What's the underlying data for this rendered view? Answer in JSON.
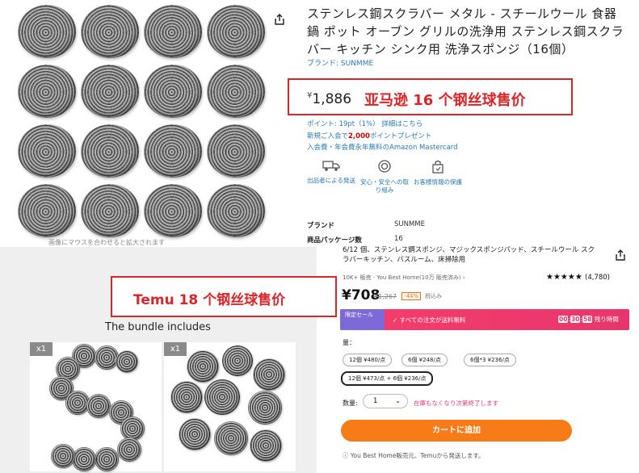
{
  "amazon": {
    "title": "ステンレス鋼スクラバー メタル - スチールウール 食器 鍋 ポット オーブン グリルの洗浄用 ステンレス鋼スクラバー キッチン シンク用 洗浄スポンジ（16個）",
    "brand_link": "ブランド: SUNMME",
    "zoom_hint": "画像にマウスを合わせると拡大されます",
    "price_symbol": "¥",
    "price": "1,886",
    "price_annotation": "亚马逊 16 个钢丝球售价",
    "points": "ポイント: 19pt（1%） 詳細はこちら",
    "promo_prefix": "新規ご入会で",
    "promo_bold": "2,000",
    "promo_suffix": "ポイントプレゼント",
    "promo_line2": "入会費・年会費永年無料のAmazon Mastercard",
    "features": [
      "出品者による発送",
      "安心・安全への取り組み",
      "お客様情報の保護"
    ],
    "specs": [
      {
        "key": "ブランド",
        "value": "SUNMME"
      },
      {
        "key": "商品パッケージ数",
        "value": "16"
      }
    ]
  },
  "temu": {
    "description": "6/12 個、ステンレス鋼スポンジ、マジックスポンジパッド、スチールウール スクラバーキッチン、バスルーム、床掃除用",
    "seller_line": "10K+ 販売 · You Best Home(10万 販売済み) ›",
    "rating_stars": "★★★★★",
    "rating_count": "(4,780)",
    "price_annotation": "Temu 18 个钢丝球售价",
    "price": "¥708",
    "price_old": "¥1,267",
    "discount_badge": "-44%",
    "badge2": "税込み",
    "sale_label": "限定セール",
    "sale_text": "✓ すべての注文が送料無料",
    "timer": [
      "00",
      "30",
      "58"
    ],
    "timer_suffix": "残り時間",
    "bundle_title": "The bundle includes",
    "bundle_badges": [
      "x1",
      "x1"
    ],
    "options_label": "量：",
    "options": [
      "12個 ¥480/点",
      "6個 ¥248/点",
      "6個*3 ¥236/点",
      "12個 ¥473/点 + 6個 ¥236/点"
    ],
    "qty_label": "数量:",
    "qty_value": "1",
    "qty_warning": "在庫もなくなり次第終了します",
    "cart_button": "カートに追加",
    "seller_note": "You Best Home販売元、Temuから発送します。"
  },
  "colors": {
    "annotation_red": "#d8262a",
    "temu_orange": "#f77b17",
    "sale_pink": "#e8366d"
  }
}
